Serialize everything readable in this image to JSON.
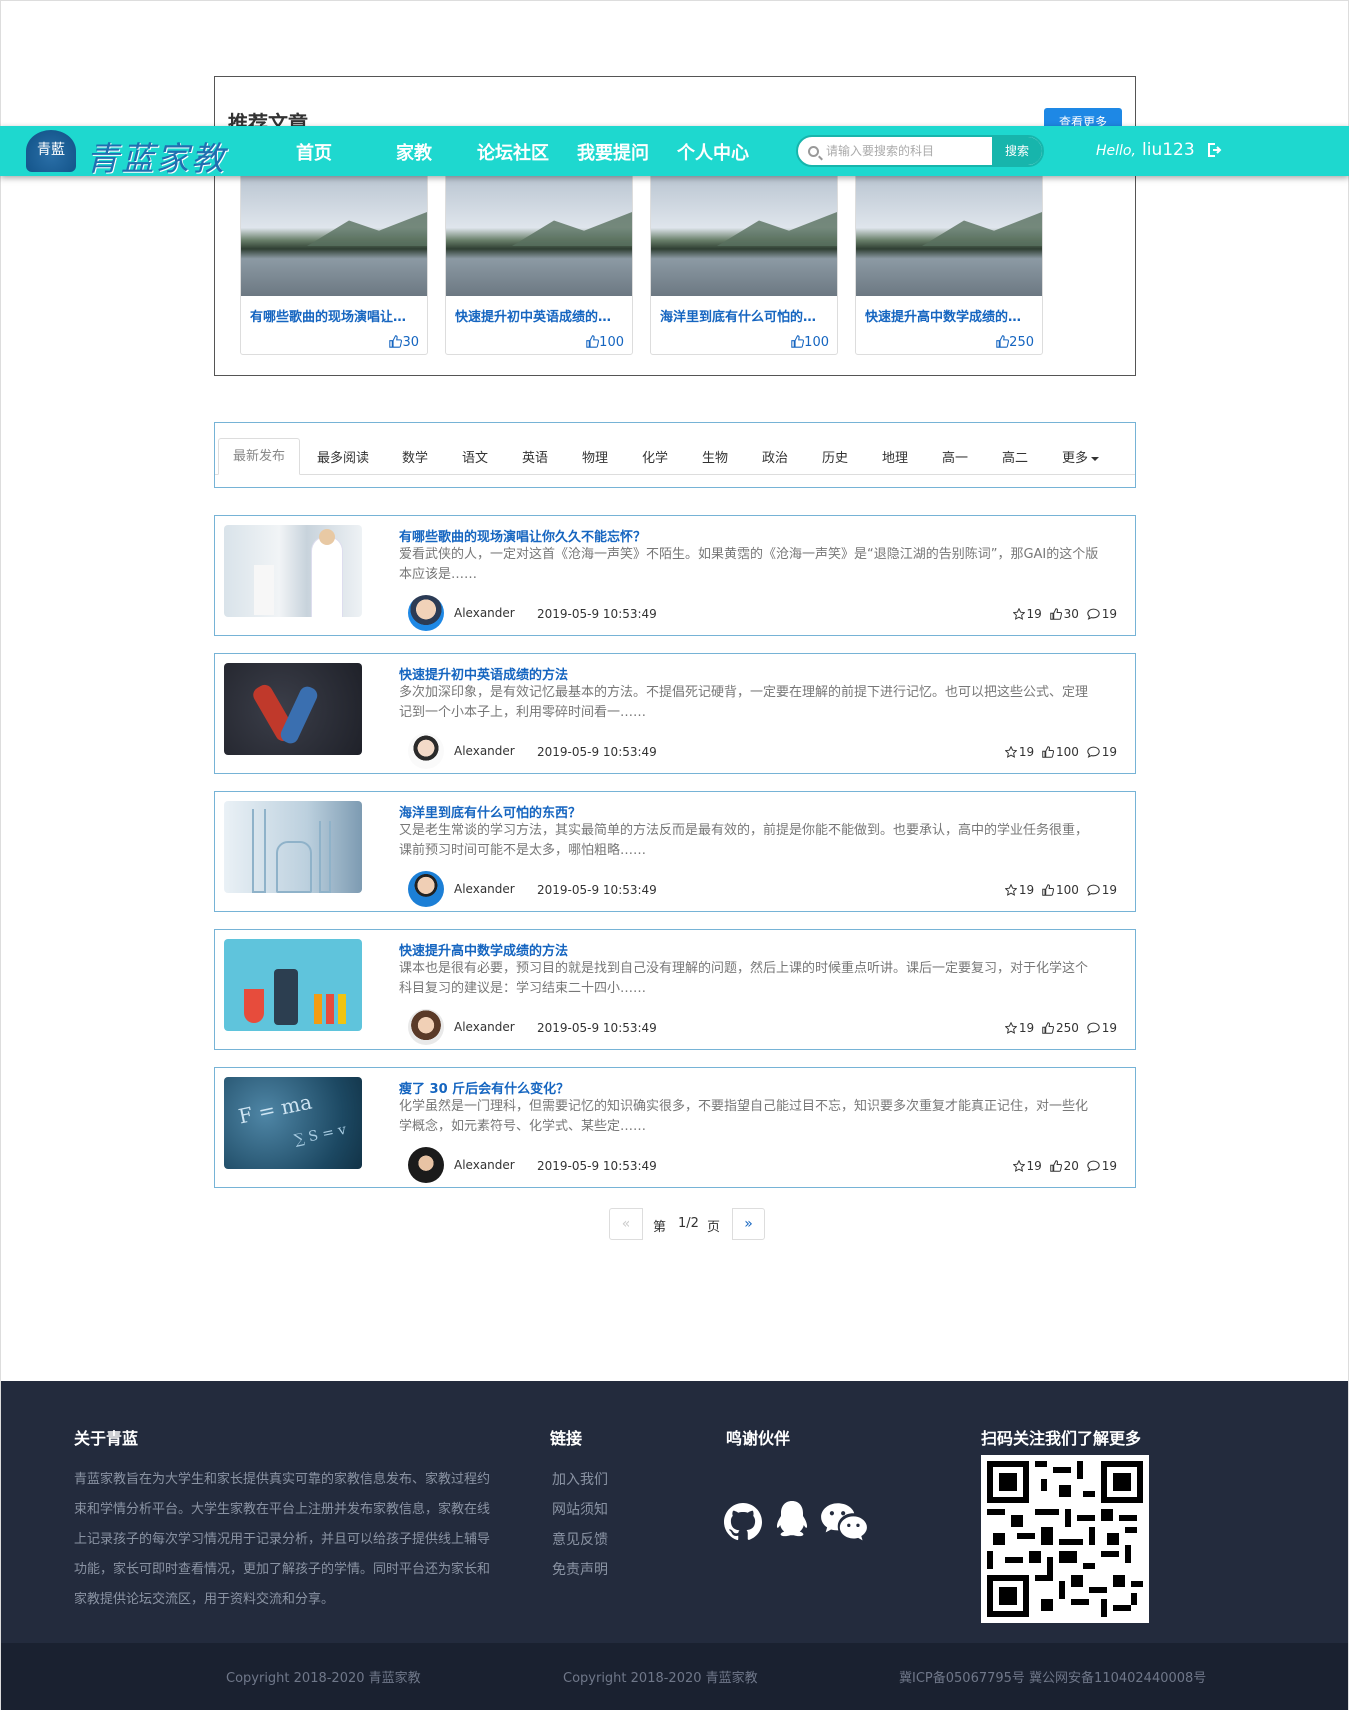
{
  "recommend": {
    "title": "推荐文章",
    "view_more": "查看更多",
    "cards": [
      {
        "title": "有哪些歌曲的现场演唱让…",
        "likes": "30"
      },
      {
        "title": "快速提升初中英语成绩的…",
        "likes": "100"
      },
      {
        "title": "海洋里到底有什么可怕的…",
        "likes": "100"
      },
      {
        "title": "快速提升高中数学成绩的…",
        "likes": "250"
      }
    ]
  },
  "header": {
    "logo_badge": "青藍",
    "logo_text": "青蓝家教",
    "nav": [
      "首页",
      "家教",
      "论坛社区",
      "我要提问",
      "个人中心"
    ],
    "search_placeholder": "请输入要搜索的科目",
    "search_button": "搜索",
    "hello": "Hello,",
    "username": "liu123"
  },
  "tabs": [
    "最新发布",
    "最多阅读",
    "数学",
    "语文",
    "英语",
    "物理",
    "化学",
    "生物",
    "政治",
    "历史",
    "地理",
    "高一",
    "高二",
    "更多"
  ],
  "articles": [
    {
      "title": "有哪些歌曲的现场演唱让你久久不能忘怀？",
      "desc": "爱看武侠的人，一定对这首《沧海一声笑》不陌生。如果黄霑的《沧海一声笑》是“退隐江湖的告别陈词”，那GAI的这个版本应该是……",
      "author": "Alexander",
      "date": "2019-05-9 10:53:49",
      "stars": "19",
      "likes": "30",
      "comments": "19"
    },
    {
      "title": "快速提升初中英语成绩的方法",
      "desc": "多次加深印象，是有效记忆最基本的方法。不提倡死记硬背，一定要在理解的前提下进行记忆。也可以把这些公式、定理记到一个小本子上，利用零碎时间看一……",
      "author": "Alexander",
      "date": "2019-05-9 10:53:49",
      "stars": "19",
      "likes": "100",
      "comments": "19"
    },
    {
      "title": "海洋里到底有什么可怕的东西？",
      "desc": "又是老生常谈的学习方法，其实最简单的方法反而是最有效的，前提是你能不能做到。也要承认，高中的学业任务很重，课前预习时间可能不是太多，哪怕粗略……",
      "author": "Alexander",
      "date": "2019-05-9 10:53:49",
      "stars": "19",
      "likes": "100",
      "comments": "19"
    },
    {
      "title": "快速提升高中数学成绩的方法",
      "desc": "课本也是很有必要，预习目的就是找到自己没有理解的问题，然后上课的时候重点听讲。课后一定要复习，对于化学这个科目复习的建议是：学习结束二十四小……",
      "author": "Alexander",
      "date": "2019-05-9 10:53:49",
      "stars": "19",
      "likes": "250",
      "comments": "19"
    },
    {
      "title": "瘦了 30 斤后会有什么变化？",
      "desc": "化学虽然是一门理科，但需要记忆的知识确实很多，不要指望自己能过目不忘，知识要多次重复才能真正记住，对一些化学概念，如元素符号、化学式、某些定……",
      "author": "Alexander",
      "date": "2019-05-9 10:53:49",
      "stars": "19",
      "likes": "20",
      "comments": "19"
    }
  ],
  "pager": {
    "prev": "«",
    "prefix": "第",
    "current": "1/2",
    "suffix": "页",
    "next": "»"
  },
  "footer": {
    "about_title": "关于青蓝",
    "about_text": "青蓝家教旨在为大学生和家长提供真实可靠的家教信息发布、家教过程约束和学情分析平台。大学生家教在平台上注册并发布家教信息，家教在线上记录孩子的每次学习情况用于记录分析，并且可以给孩子提供线上辅导功能，家长可即时查看情况，更加了解孩子的学情。同时平台还为家长和家教提供论坛交流区，用于资料交流和分享。",
    "links_title": "链接",
    "links": [
      "加入我们",
      "网站须知",
      "意见反馈",
      "免责声明"
    ],
    "partners_title": "鸣谢伙伴",
    "qr_title": "扫码关注我们了解更多",
    "copyright_1": "Copyright 2018-2020   青蓝家教",
    "copyright_2": "Copyright 2018-2020   青蓝家教",
    "icp": "冀ICP备05067795号 冀公网安备110402440008号"
  }
}
